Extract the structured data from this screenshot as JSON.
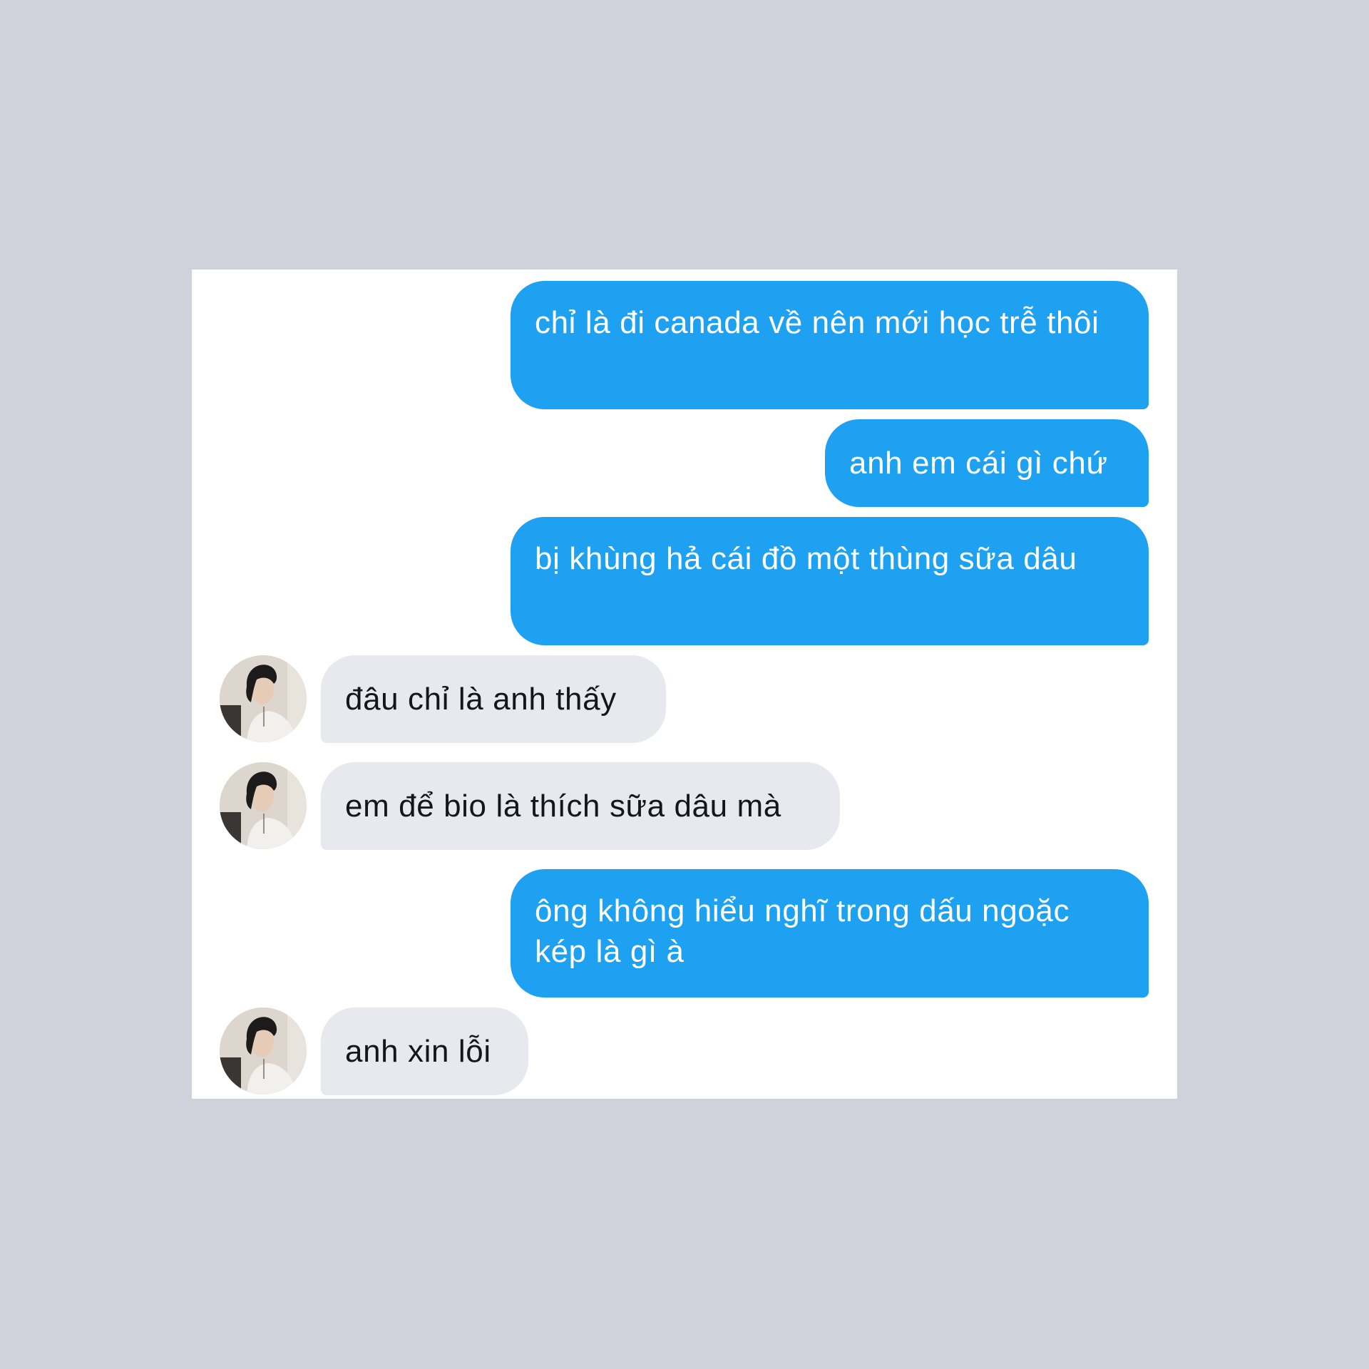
{
  "colors": {
    "background": "#cfd2db",
    "card": "#ffffff",
    "outgoing_bubble": "#1ea1f1",
    "outgoing_text": "#ffffff",
    "incoming_bubble": "#e7e9ef",
    "incoming_text": "#14171a"
  },
  "messages": [
    {
      "direction": "outgoing",
      "text": "chỉ là đi canada về nên mới học trễ thôi"
    },
    {
      "direction": "outgoing",
      "text": "anh em cái gì chứ"
    },
    {
      "direction": "outgoing",
      "text": "bị khùng hả cái đồ một thùng sữa dâu"
    },
    {
      "direction": "incoming",
      "text": "đâu chỉ là anh thấy",
      "avatar": "profile-photo-icon"
    },
    {
      "direction": "incoming",
      "text": "em để bio là thích sữa dâu mà",
      "avatar": "profile-photo-icon"
    },
    {
      "direction": "outgoing",
      "text": "ông không hiểu nghĩ trong dấu ngoặc kép là gì à"
    },
    {
      "direction": "incoming",
      "text": "anh xin lỗi",
      "avatar": "profile-photo-icon"
    }
  ]
}
